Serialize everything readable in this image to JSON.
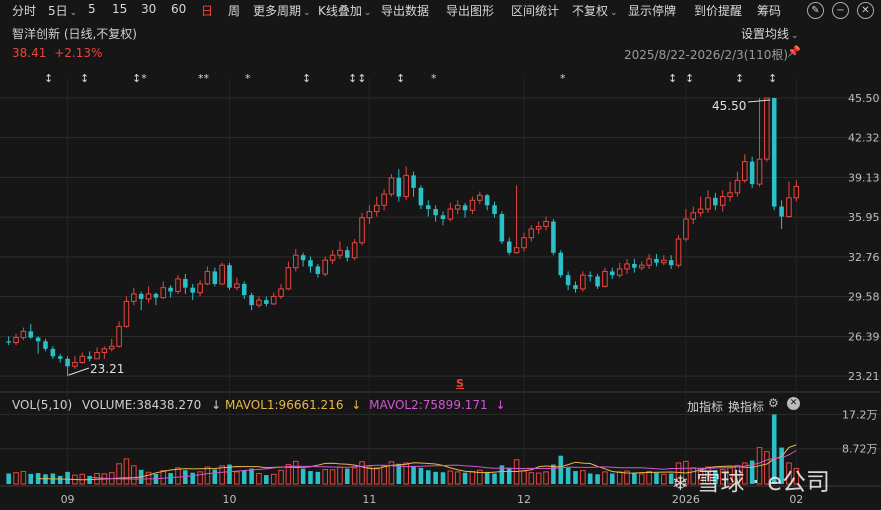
{
  "toolbar": {
    "items": [
      {
        "label": "分时",
        "caret": false,
        "active": false
      },
      {
        "label": "5日",
        "caret": true,
        "active": false
      },
      {
        "label": "5",
        "caret": false,
        "active": false
      },
      {
        "label": "15",
        "caret": false,
        "active": false
      },
      {
        "label": "30",
        "caret": false,
        "active": false
      },
      {
        "label": "60",
        "caret": false,
        "active": false
      },
      {
        "label": "日",
        "caret": false,
        "active": true
      },
      {
        "label": "周",
        "caret": false,
        "active": false
      },
      {
        "label": "更多周期",
        "caret": true,
        "active": false
      },
      {
        "label": "K线叠加",
        "caret": true,
        "active": false
      },
      {
        "label": "导出数据",
        "caret": false,
        "active": false
      },
      {
        "label": "导出图形",
        "caret": false,
        "active": false
      },
      {
        "label": "区间统计",
        "caret": false,
        "active": false
      },
      {
        "label": "不复权",
        "caret": true,
        "active": false
      },
      {
        "label": "显示停牌",
        "caret": false,
        "active": false
      },
      {
        "label": "到价提醒",
        "caret": false,
        "active": false
      },
      {
        "label": "筹码",
        "caret": false,
        "active": false
      }
    ],
    "icon_buttons": [
      {
        "name": "edit-icon",
        "glyph": "✎"
      },
      {
        "name": "minus-icon",
        "glyph": "−"
      },
      {
        "name": "close-icon",
        "glyph": "✕"
      }
    ]
  },
  "stock": {
    "title": "智洋创新 (日线,不复权)",
    "price": "38.41",
    "change": "+2.13%",
    "range_label": "2025/8/22-2026/2/3(110根)",
    "ma_setting": "设置均线"
  },
  "annotations": {
    "high_label": "45.50",
    "low_label": "23.21",
    "markers": [
      "↕",
      "↕",
      "↕*",
      "**",
      "*",
      "↕",
      "↕↕",
      "↕",
      "*",
      "*",
      "↕",
      "↕",
      "↕",
      "↕"
    ],
    "s_marker": "S"
  },
  "volume_panel": {
    "vol": "VOL(5,10)",
    "volume": "VOLUME:38438.270",
    "mavol1": "MAVOL1:96661.216",
    "mavol2": "MAVOL2:75899.171",
    "add_indicator": "加指标",
    "switch_indicator": "换指标",
    "mavol1_color": "#e8b84a",
    "mavol2_color": "#cf57d1"
  },
  "watermark": "雪球 · e公司",
  "colors": {
    "up": "#e9453f",
    "down": "#2bc0c8",
    "background": "#161616",
    "grid": "#2c2c2c"
  },
  "chart_data": {
    "type": "candlestick",
    "price_ticks": [
      "45.50",
      "42.32",
      "39.13",
      "35.95",
      "32.76",
      "29.58",
      "26.39",
      "23.21"
    ],
    "volume_ticks": [
      "17.2万",
      "8.72万"
    ],
    "x_ticks": [
      "09",
      "10",
      "11",
      "12",
      "2026",
      "02"
    ],
    "ylim": [
      22.5,
      46.3
    ],
    "candles": [
      [
        26.0,
        25.9,
        26.4,
        25.7,
        26.0
      ],
      [
        25.9,
        26.3,
        26.6,
        25.7,
        28.0
      ],
      [
        26.3,
        26.8,
        27.1,
        26.1,
        31.0
      ],
      [
        26.8,
        26.3,
        27.4,
        26.2,
        25.0
      ],
      [
        26.3,
        26.0,
        26.4,
        25.0,
        27.0
      ],
      [
        26.0,
        25.4,
        26.2,
        25.2,
        24.0
      ],
      [
        25.4,
        24.8,
        25.6,
        24.6,
        26.0
      ],
      [
        24.8,
        24.6,
        25.0,
        24.3,
        20.0
      ],
      [
        24.6,
        24.0,
        24.8,
        23.21,
        30.0
      ],
      [
        24.0,
        24.3,
        24.8,
        23.8,
        22.0
      ],
      [
        24.3,
        24.8,
        25.1,
        24.2,
        24.0
      ],
      [
        24.8,
        24.6,
        25.2,
        24.4,
        20.0
      ],
      [
        24.6,
        25.1,
        25.5,
        24.6,
        26.0
      ],
      [
        25.1,
        25.4,
        25.6,
        24.6,
        25.0
      ],
      [
        25.4,
        25.6,
        26.2,
        25.2,
        28.0
      ],
      [
        25.6,
        27.2,
        27.6,
        25.5,
        50.0
      ],
      [
        27.2,
        29.2,
        29.6,
        27.1,
        62.0
      ],
      [
        29.2,
        29.8,
        30.3,
        28.9,
        45.0
      ],
      [
        29.8,
        29.4,
        30.0,
        28.5,
        35.0
      ],
      [
        29.4,
        29.8,
        30.4,
        29.1,
        29.0
      ],
      [
        29.8,
        29.5,
        29.9,
        28.9,
        25.0
      ],
      [
        29.5,
        30.3,
        30.8,
        29.4,
        33.0
      ],
      [
        30.3,
        30.0,
        30.5,
        29.5,
        27.0
      ],
      [
        30.0,
        31.0,
        31.3,
        29.8,
        40.0
      ],
      [
        31.0,
        30.3,
        31.4,
        29.8,
        34.0
      ],
      [
        30.3,
        29.9,
        30.6,
        29.3,
        28.0
      ],
      [
        29.9,
        30.6,
        30.9,
        29.6,
        30.0
      ],
      [
        30.6,
        31.6,
        32.0,
        30.5,
        42.0
      ],
      [
        31.6,
        30.6,
        31.9,
        30.4,
        36.0
      ],
      [
        30.6,
        32.1,
        32.3,
        30.5,
        45.0
      ],
      [
        32.1,
        30.3,
        32.3,
        30.1,
        48.0
      ],
      [
        30.3,
        30.6,
        31.1,
        30.1,
        30.0
      ],
      [
        30.6,
        29.7,
        30.8,
        29.4,
        33.0
      ],
      [
        29.7,
        28.9,
        29.9,
        28.5,
        38.0
      ],
      [
        28.9,
        29.3,
        29.6,
        28.7,
        26.0
      ],
      [
        29.3,
        29.0,
        29.6,
        28.8,
        22.0
      ],
      [
        29.0,
        29.6,
        29.9,
        28.9,
        24.0
      ],
      [
        29.6,
        30.2,
        30.6,
        29.4,
        34.0
      ],
      [
        30.2,
        31.9,
        32.4,
        30.1,
        48.0
      ],
      [
        31.9,
        32.9,
        33.4,
        31.6,
        56.0
      ],
      [
        32.9,
        32.5,
        33.1,
        32.0,
        38.0
      ],
      [
        32.5,
        32.0,
        32.8,
        31.5,
        32.0
      ],
      [
        32.0,
        31.4,
        32.2,
        31.1,
        30.0
      ],
      [
        31.4,
        32.5,
        32.8,
        31.2,
        36.0
      ],
      [
        32.5,
        32.9,
        33.3,
        32.2,
        35.0
      ],
      [
        32.9,
        33.3,
        34.0,
        32.6,
        42.0
      ],
      [
        33.3,
        32.7,
        33.6,
        32.4,
        38.0
      ],
      [
        32.7,
        33.9,
        34.2,
        32.5,
        40.0
      ],
      [
        33.9,
        35.9,
        36.3,
        33.7,
        55.0
      ],
      [
        35.9,
        36.4,
        36.9,
        35.4,
        42.0
      ],
      [
        36.4,
        36.9,
        37.6,
        36.0,
        40.0
      ],
      [
        36.9,
        37.8,
        38.2,
        36.5,
        45.0
      ],
      [
        37.8,
        39.1,
        39.4,
        37.6,
        55.0
      ],
      [
        39.1,
        37.6,
        39.8,
        37.2,
        50.0
      ],
      [
        37.6,
        39.3,
        40.0,
        37.3,
        52.0
      ],
      [
        39.3,
        38.3,
        39.6,
        37.6,
        44.0
      ],
      [
        38.3,
        36.9,
        38.5,
        36.6,
        40.0
      ],
      [
        36.9,
        36.6,
        37.3,
        36.0,
        34.0
      ],
      [
        36.6,
        36.1,
        36.9,
        35.6,
        30.0
      ],
      [
        36.1,
        35.8,
        36.4,
        35.3,
        29.0
      ],
      [
        35.8,
        36.6,
        37.1,
        35.6,
        32.0
      ],
      [
        36.6,
        36.9,
        37.3,
        36.2,
        30.0
      ],
      [
        36.9,
        36.5,
        37.1,
        35.9,
        28.0
      ],
      [
        36.5,
        37.3,
        37.6,
        36.2,
        31.0
      ],
      [
        37.3,
        37.7,
        38.0,
        37.0,
        34.0
      ],
      [
        37.7,
        36.9,
        37.8,
        36.5,
        30.0
      ],
      [
        36.9,
        36.2,
        37.2,
        35.9,
        26.0
      ],
      [
        36.2,
        34.0,
        36.4,
        33.8,
        46.0
      ],
      [
        34.0,
        33.1,
        34.3,
        32.9,
        40.0
      ],
      [
        33.1,
        33.5,
        38.5,
        33.0,
        60.0
      ],
      [
        33.5,
        34.3,
        34.7,
        33.2,
        32.0
      ],
      [
        34.3,
        35.0,
        35.3,
        34.0,
        28.0
      ],
      [
        35.0,
        35.2,
        35.6,
        34.6,
        27.0
      ],
      [
        35.2,
        35.6,
        36.0,
        34.9,
        30.0
      ],
      [
        35.6,
        33.1,
        35.8,
        32.9,
        48.0
      ],
      [
        33.1,
        31.3,
        33.3,
        31.1,
        70.0
      ],
      [
        31.3,
        30.5,
        31.6,
        30.1,
        40.0
      ],
      [
        30.5,
        30.2,
        30.8,
        29.9,
        32.0
      ],
      [
        30.2,
        31.3,
        31.6,
        30.0,
        33.0
      ],
      [
        31.3,
        31.2,
        31.6,
        30.8,
        26.0
      ],
      [
        31.2,
        30.4,
        31.4,
        30.2,
        24.0
      ],
      [
        30.4,
        31.6,
        31.9,
        30.3,
        30.0
      ],
      [
        31.6,
        31.3,
        31.9,
        31.0,
        26.0
      ],
      [
        31.3,
        31.8,
        32.3,
        31.1,
        30.0
      ],
      [
        31.8,
        32.2,
        32.6,
        31.4,
        32.0
      ],
      [
        32.2,
        31.9,
        32.6,
        31.5,
        28.0
      ],
      [
        31.9,
        32.1,
        32.4,
        31.7,
        25.0
      ],
      [
        32.1,
        32.6,
        33.0,
        31.8,
        31.0
      ],
      [
        32.6,
        32.3,
        33.0,
        32.0,
        28.0
      ],
      [
        32.3,
        32.5,
        32.9,
        32.1,
        24.0
      ],
      [
        32.5,
        32.1,
        32.9,
        31.8,
        26.0
      ],
      [
        32.1,
        34.2,
        34.5,
        31.9,
        52.0
      ],
      [
        34.2,
        35.8,
        36.6,
        34.0,
        56.0
      ],
      [
        35.8,
        36.3,
        36.8,
        35.4,
        40.0
      ],
      [
        36.3,
        36.6,
        37.6,
        36.0,
        38.0
      ],
      [
        36.6,
        37.5,
        38.1,
        36.3,
        42.0
      ],
      [
        37.5,
        36.9,
        37.9,
        36.5,
        34.0
      ],
      [
        36.9,
        37.6,
        38.1,
        36.4,
        36.0
      ],
      [
        37.6,
        37.9,
        38.8,
        37.2,
        40.0
      ],
      [
        37.9,
        38.9,
        39.6,
        37.6,
        46.0
      ],
      [
        38.9,
        40.4,
        41.0,
        38.7,
        52.0
      ],
      [
        40.4,
        38.6,
        40.8,
        38.3,
        58.0
      ],
      [
        38.6,
        40.6,
        45.5,
        38.4,
        90.0
      ],
      [
        40.6,
        45.5,
        45.5,
        40.4,
        80.0
      ],
      [
        45.5,
        36.8,
        45.5,
        36.5,
        172.0
      ],
      [
        36.8,
        36.0,
        37.3,
        35.0,
        90.0
      ],
      [
        36.0,
        37.5,
        38.8,
        35.9,
        52.0
      ],
      [
        37.5,
        38.41,
        38.9,
        37.2,
        38.4
      ]
    ],
    "ma5": [
      13.2,
      12.9,
      12.5,
      12.3,
      11.8,
      11.2,
      10.5,
      10.8,
      11.6,
      12.4,
      13.3,
      14.5,
      15.1,
      15.9,
      17.2,
      22.1,
      27.7,
      31.2,
      34.6,
      36.5,
      38.0,
      37.3,
      37.8,
      38.0,
      38.4,
      40.3,
      41.2,
      43.2,
      42.9,
      43.0,
      42.4,
      40.2,
      41.0,
      41.8,
      42.1,
      41.1,
      41.4,
      42.6,
      46.6,
      51.0,
      51.2,
      49.8,
      48.7,
      46.8,
      42.2,
      38.4,
      37.7,
      42.5,
      46.1,
      47.2,
      49.0,
      52.4,
      51.8,
      50.6,
      49.4,
      45.8,
      39.8,
      35.4,
      31.6,
      29.8,
      28.5,
      28.1,
      29.3,
      30.8,
      31.2,
      30.9,
      33.2,
      34.9,
      42.6,
      44.4,
      43.1,
      42.4,
      48.0,
      53.8,
      51.6,
      50.6,
      43.6,
      37.6,
      31.0,
      28.8,
      27.2,
      27.0,
      28.2,
      28.4,
      29.0,
      29.4,
      29.6,
      28.6,
      27.2,
      30.3,
      35.1,
      40.0,
      42.6,
      43.6,
      44.4,
      43.0,
      41.6,
      41.0,
      45.2,
      49.4,
      62.4,
      67.4,
      90.4,
      96.7
    ],
    "ma10": [
      16.2,
      15.4,
      14.2,
      13.3,
      12.5,
      12.4,
      12.0,
      12.2,
      12.6,
      13.2,
      14.4,
      15.7,
      17.1,
      18.5,
      20.4,
      23.1,
      25.7,
      27.1,
      29.0,
      30.3,
      31.8,
      33.4,
      34.5,
      36.0,
      37.4,
      39.9,
      41.2,
      43.3,
      43.8,
      43.6,
      43.4,
      42.5,
      42.7,
      42.0,
      41.4,
      41.4,
      42.8,
      43.8,
      45.6,
      46.6,
      46.4,
      45.2,
      44.0,
      43.1,
      43.6,
      43.9,
      44.6,
      45.2,
      45.6,
      46.6,
      46.8,
      44.8,
      43.9,
      42.3,
      40.4,
      39.0,
      39.1,
      38.7,
      38.2,
      38.4,
      38.6,
      38.2,
      38.2,
      38.4,
      40.1,
      41.7,
      41.3,
      41.0,
      41.0,
      42.1,
      42.2,
      41.5,
      40.1,
      40.3,
      40.4,
      40.3,
      39.1,
      37.6,
      36.7,
      38.3,
      38.4,
      38.7,
      38.8,
      38.8,
      38.8,
      39.6,
      40.1,
      40.7,
      42.4,
      44.4,
      47.8,
      52.0,
      59.7,
      63.3,
      65.0,
      72.2,
      82.9
    ]
  }
}
